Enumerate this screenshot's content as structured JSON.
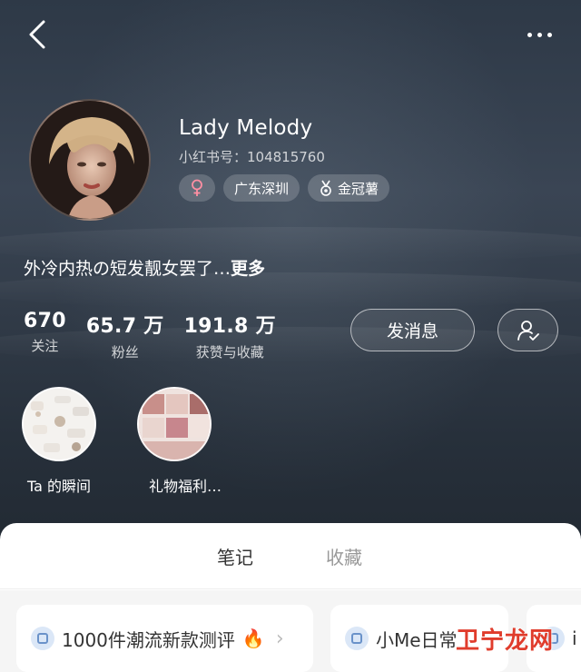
{
  "header": {
    "back_icon": "chevron-left-icon",
    "more_icon": "more-dots-icon"
  },
  "profile": {
    "name": "Lady Melody",
    "id_text": "小红书号：104815760",
    "gender_icon": "female-icon",
    "location_tag": "广东深圳",
    "badge_tag": "金冠薯",
    "bio": "外冷内热の短发靓女罢了…",
    "bio_more": "更多"
  },
  "stats": [
    {
      "value": "670",
      "label": "关注"
    },
    {
      "value": "65.7 万",
      "label": "粉丝"
    },
    {
      "value": "191.8 万",
      "label": "获赞与收藏"
    }
  ],
  "actions": {
    "message_label": "发消息",
    "follow_icon": "user-check-icon"
  },
  "highlights": [
    {
      "label": "Ta 的瞬间"
    },
    {
      "label": "礼物福利…"
    }
  ],
  "tabs": [
    {
      "label": "笔记",
      "active": true
    },
    {
      "label": "收藏",
      "active": false
    }
  ],
  "collections": [
    {
      "title": "1000件潮流新款测评",
      "emoji": "🔥"
    },
    {
      "title": "小Me日常"
    },
    {
      "title": "i"
    }
  ],
  "watermark": "卫宁龙网",
  "colors": {
    "accent": "#ff2442",
    "hero_bg": "#323c49"
  }
}
